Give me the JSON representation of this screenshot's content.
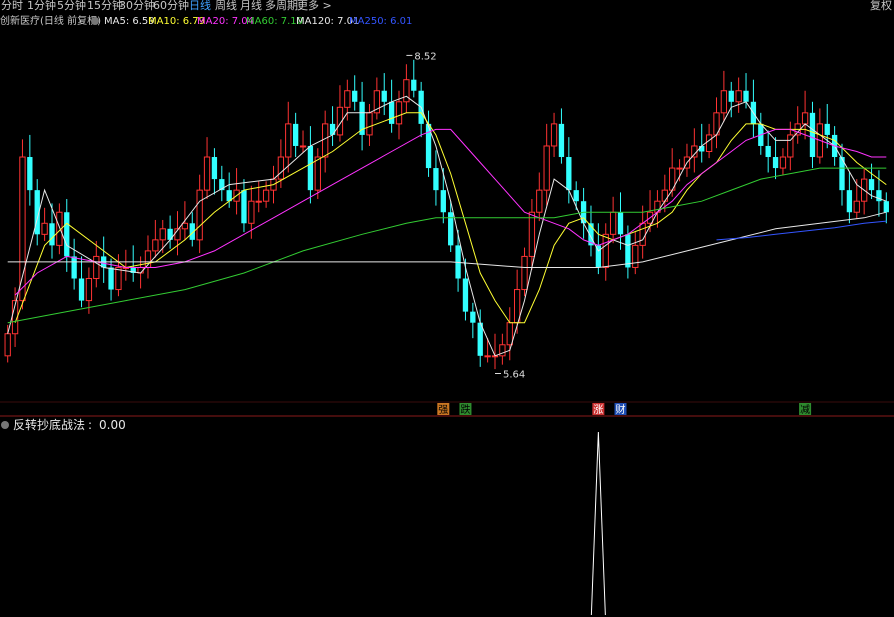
{
  "toolbar": {
    "tabs": [
      {
        "label": "分时",
        "active": false
      },
      {
        "label": "1分钟",
        "active": false
      },
      {
        "label": "5分钟",
        "active": false
      },
      {
        "label": "15分钟",
        "active": false
      },
      {
        "label": "30分钟",
        "active": false
      },
      {
        "label": "60分钟",
        "active": false
      },
      {
        "label": "日线",
        "active": true
      },
      {
        "label": "周线",
        "active": false
      },
      {
        "label": "月线",
        "active": false
      },
      {
        "label": "多周期",
        "active": false
      },
      {
        "label": "更多 >",
        "active": false
      }
    ],
    "corner": "复权"
  },
  "stock": {
    "name": "创新医疗(日线 前复权)",
    "ma": [
      {
        "label": "MA5: 6.59",
        "color": "#e8e8e8"
      },
      {
        "label": "MA10: 6.79",
        "color": "#ffff33"
      },
      {
        "label": "MA20: 7.04",
        "color": "#ff33ff"
      },
      {
        "label": "MA60: 7.10",
        "color": "#33cc33"
      },
      {
        "label": "MA120: 7.01",
        "color": "#e8e8e8"
      },
      {
        "label": "MA250: 6.01",
        "color": "#3355ff"
      }
    ]
  },
  "colors": {
    "up": "#ff3333",
    "down": "#33ffff",
    "bg": "#000000"
  },
  "chart_data": [
    {
      "type": "candlestick",
      "ylim": [
        5.4,
        8.75
      ],
      "high_label": "8.52",
      "low_label": "5.64",
      "closes": [
        6.0,
        6.3,
        7.6,
        7.3,
        6.9,
        7.0,
        6.8,
        7.1,
        6.7,
        6.5,
        6.3,
        6.5,
        6.7,
        6.6,
        6.4,
        6.6,
        6.6,
        6.55,
        6.6,
        6.75,
        6.85,
        6.95,
        6.85,
        6.95,
        7.0,
        6.85,
        7.3,
        7.6,
        7.4,
        7.3,
        7.2,
        7.3,
        7.0,
        7.2,
        7.2,
        7.3,
        7.4,
        7.6,
        7.9,
        7.7,
        7.7,
        7.3,
        7.6,
        7.9,
        7.8,
        8.05,
        8.2,
        8.1,
        7.8,
        8.0,
        8.2,
        8.1,
        7.9,
        8.1,
        8.3,
        8.2,
        7.9,
        7.5,
        7.3,
        7.1,
        6.8,
        6.5,
        6.2,
        6.1,
        5.8,
        5.8,
        5.8,
        5.9,
        6.1,
        6.4,
        6.7,
        7.1,
        7.3,
        7.7,
        7.9,
        7.6,
        7.3,
        7.2,
        7.0,
        6.8,
        6.6,
        6.9,
        7.1,
        6.9,
        6.6,
        6.8,
        7.0,
        7.1,
        7.2,
        7.3,
        7.5,
        7.5,
        7.6,
        7.7,
        7.65,
        7.8,
        8.0,
        8.2,
        8.1,
        8.2,
        8.1,
        7.9,
        7.7,
        7.6,
        7.5,
        7.6,
        7.8,
        7.9,
        8.0,
        7.6,
        7.9,
        7.8,
        7.6,
        7.3,
        7.1,
        7.2,
        7.4,
        7.3,
        7.2,
        7.1
      ],
      "ma_lines": {
        "MA5": [
          [
            0,
            6.0
          ],
          [
            5,
            7.3
          ],
          [
            8,
            6.8
          ],
          [
            13,
            6.6
          ],
          [
            18,
            6.55
          ],
          [
            22,
            6.85
          ],
          [
            26,
            7.2
          ],
          [
            30,
            7.35
          ],
          [
            36,
            7.4
          ],
          [
            41,
            7.7
          ],
          [
            44,
            7.8
          ],
          [
            46,
            8.0
          ],
          [
            49,
            8.0
          ],
          [
            52,
            8.1
          ],
          [
            54,
            8.15
          ],
          [
            56,
            8.05
          ],
          [
            58,
            7.7
          ],
          [
            60,
            7.2
          ],
          [
            62,
            6.6
          ],
          [
            64,
            6.1
          ],
          [
            66,
            5.8
          ],
          [
            68,
            5.85
          ],
          [
            70,
            6.3
          ],
          [
            72,
            6.9
          ],
          [
            74,
            7.4
          ],
          [
            76,
            7.3
          ],
          [
            78,
            7.0
          ],
          [
            80,
            6.75
          ],
          [
            82,
            6.85
          ],
          [
            84,
            6.8
          ],
          [
            86,
            6.85
          ],
          [
            88,
            7.1
          ],
          [
            90,
            7.3
          ],
          [
            92,
            7.55
          ],
          [
            94,
            7.7
          ],
          [
            96,
            7.8
          ],
          [
            98,
            8.05
          ],
          [
            100,
            8.1
          ],
          [
            102,
            7.9
          ],
          [
            104,
            7.75
          ],
          [
            106,
            7.75
          ],
          [
            108,
            7.9
          ],
          [
            110,
            7.8
          ],
          [
            112,
            7.7
          ],
          [
            115,
            7.35
          ],
          [
            117,
            7.25
          ],
          [
            119,
            7.2
          ]
        ],
        "MA10": [
          [
            1,
            6.1
          ],
          [
            5,
            6.8
          ],
          [
            8,
            7.0
          ],
          [
            12,
            6.8
          ],
          [
            16,
            6.6
          ],
          [
            20,
            6.65
          ],
          [
            24,
            6.85
          ],
          [
            28,
            7.1
          ],
          [
            32,
            7.3
          ],
          [
            36,
            7.35
          ],
          [
            40,
            7.5
          ],
          [
            44,
            7.65
          ],
          [
            48,
            7.85
          ],
          [
            52,
            7.95
          ],
          [
            54,
            8.0
          ],
          [
            56,
            8.0
          ],
          [
            58,
            7.8
          ],
          [
            60,
            7.45
          ],
          [
            62,
            7.0
          ],
          [
            64,
            6.55
          ],
          [
            66,
            6.3
          ],
          [
            68,
            6.1
          ],
          [
            70,
            6.1
          ],
          [
            72,
            6.4
          ],
          [
            74,
            6.8
          ],
          [
            76,
            7.0
          ],
          [
            78,
            7.05
          ],
          [
            80,
            6.9
          ],
          [
            82,
            6.85
          ],
          [
            84,
            6.9
          ],
          [
            86,
            6.95
          ],
          [
            88,
            7.0
          ],
          [
            90,
            7.1
          ],
          [
            92,
            7.3
          ],
          [
            94,
            7.45
          ],
          [
            96,
            7.55
          ],
          [
            98,
            7.75
          ],
          [
            100,
            7.9
          ],
          [
            102,
            7.9
          ],
          [
            104,
            7.85
          ],
          [
            106,
            7.85
          ],
          [
            108,
            7.85
          ],
          [
            110,
            7.8
          ],
          [
            112,
            7.75
          ],
          [
            115,
            7.55
          ],
          [
            117,
            7.45
          ],
          [
            119,
            7.35
          ]
        ],
        "MA20": [
          [
            1,
            6.35
          ],
          [
            4,
            6.55
          ],
          [
            8,
            6.7
          ],
          [
            12,
            6.65
          ],
          [
            16,
            6.6
          ],
          [
            20,
            6.6
          ],
          [
            24,
            6.65
          ],
          [
            28,
            6.75
          ],
          [
            32,
            6.9
          ],
          [
            36,
            7.05
          ],
          [
            40,
            7.2
          ],
          [
            44,
            7.35
          ],
          [
            48,
            7.5
          ],
          [
            52,
            7.65
          ],
          [
            56,
            7.8
          ],
          [
            58,
            7.85
          ],
          [
            60,
            7.85
          ],
          [
            62,
            7.7
          ],
          [
            64,
            7.55
          ],
          [
            66,
            7.4
          ],
          [
            68,
            7.25
          ],
          [
            70,
            7.1
          ],
          [
            72,
            7.05
          ],
          [
            74,
            7.0
          ],
          [
            76,
            6.95
          ],
          [
            78,
            6.85
          ],
          [
            80,
            6.8
          ],
          [
            82,
            6.85
          ],
          [
            84,
            6.9
          ],
          [
            86,
            7.0
          ],
          [
            88,
            7.1
          ],
          [
            90,
            7.2
          ],
          [
            92,
            7.35
          ],
          [
            94,
            7.45
          ],
          [
            96,
            7.55
          ],
          [
            98,
            7.65
          ],
          [
            100,
            7.75
          ],
          [
            102,
            7.8
          ],
          [
            104,
            7.85
          ],
          [
            106,
            7.85
          ],
          [
            108,
            7.8
          ],
          [
            110,
            7.75
          ],
          [
            112,
            7.7
          ],
          [
            115,
            7.65
          ],
          [
            117,
            7.6
          ],
          [
            119,
            7.6
          ]
        ],
        "MA60": [
          [
            0,
            6.1
          ],
          [
            8,
            6.2
          ],
          [
            16,
            6.3
          ],
          [
            24,
            6.4
          ],
          [
            32,
            6.55
          ],
          [
            40,
            6.75
          ],
          [
            48,
            6.9
          ],
          [
            54,
            7.0
          ],
          [
            58,
            7.05
          ],
          [
            62,
            7.05
          ],
          [
            66,
            7.05
          ],
          [
            70,
            7.05
          ],
          [
            74,
            7.05
          ],
          [
            78,
            7.1
          ],
          [
            82,
            7.1
          ],
          [
            86,
            7.1
          ],
          [
            90,
            7.15
          ],
          [
            94,
            7.2
          ],
          [
            98,
            7.3
          ],
          [
            102,
            7.4
          ],
          [
            106,
            7.45
          ],
          [
            110,
            7.5
          ],
          [
            114,
            7.5
          ],
          [
            117,
            7.5
          ],
          [
            119,
            7.5
          ]
        ],
        "MA120": [
          [
            0,
            6.65
          ],
          [
            10,
            6.65
          ],
          [
            20,
            6.65
          ],
          [
            30,
            6.65
          ],
          [
            40,
            6.65
          ],
          [
            50,
            6.65
          ],
          [
            60,
            6.65
          ],
          [
            70,
            6.6
          ],
          [
            80,
            6.6
          ],
          [
            86,
            6.65
          ],
          [
            92,
            6.75
          ],
          [
            98,
            6.85
          ],
          [
            104,
            6.95
          ],
          [
            110,
            7.0
          ],
          [
            116,
            7.05
          ],
          [
            119,
            7.1
          ]
        ],
        "MA250": [
          [
            96,
            6.85
          ],
          [
            100,
            6.87
          ],
          [
            104,
            6.9
          ],
          [
            108,
            6.93
          ],
          [
            112,
            6.96
          ],
          [
            116,
            7.0
          ],
          [
            119,
            7.02
          ]
        ]
      }
    },
    {
      "type": "line",
      "title": "反转抄底战法",
      "value_label": "0.00",
      "peak_index": 80,
      "peak_value": 1,
      "ylim": [
        0,
        1
      ]
    }
  ],
  "signals": [
    {
      "label": "强",
      "index": 59,
      "bg": "#cc7722",
      "fg": "#000000"
    },
    {
      "label": "跌",
      "index": 62,
      "bg": "#2e8b2e",
      "fg": "#000000"
    },
    {
      "label": "涨",
      "index": 80,
      "bg": "#cc3333",
      "fg": "#ffffff"
    },
    {
      "label": "财",
      "index": 83,
      "bg": "#1f4fb5",
      "fg": "#ffffff"
    },
    {
      "label": "减",
      "index": 108,
      "bg": "#2e8b2e",
      "fg": "#000000"
    }
  ]
}
